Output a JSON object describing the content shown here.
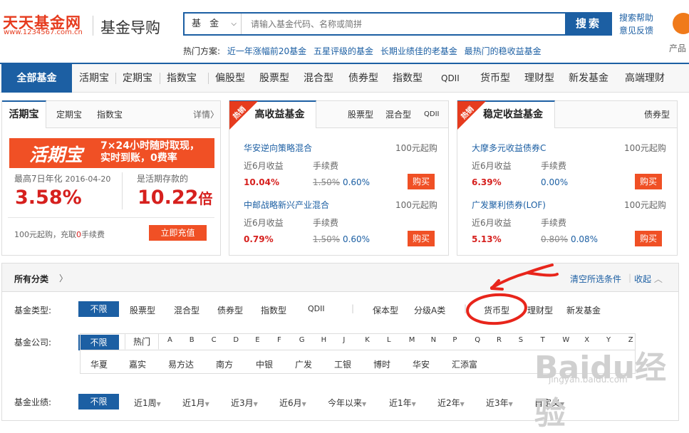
{
  "header": {
    "logo_main": "天天基金网",
    "logo_url": "www.1234567.com.cn",
    "logo_sub": "基金导购",
    "search_type": "基 金",
    "search_placeholder": "请输入基金代码、名称或简拼",
    "search_button": "搜索",
    "help_link": "搜索帮助",
    "feedback_link": "意见反馈",
    "product_label": "产品",
    "hot_label": "热门方案:",
    "hot_links": [
      "近一年涨幅前20基金",
      "五星评级的基金",
      "长期业绩佳的老基金",
      "最热门的稳收益基金"
    ]
  },
  "nav": {
    "items": [
      "全部基金",
      "活期宝",
      "定期宝",
      "指数宝",
      "偏股型",
      "股票型",
      "混合型",
      "债券型",
      "指数型",
      "QDII",
      "货币型",
      "理财型",
      "新发基金",
      "高端理财"
    ]
  },
  "card1": {
    "tabs": [
      "活期宝",
      "定期宝",
      "指数宝"
    ],
    "more": "详情",
    "promo_title": "活期宝",
    "promo_line1": "7×24小时随时取现，",
    "promo_line2": "实时到账，0费率",
    "yield_label": "最高7日年化",
    "yield_date": "2016-04-20",
    "yield_value": "3.58%",
    "compare_label": "是活期存款的",
    "compare_value": "10.22",
    "compare_unit": "倍",
    "footer_text_a": "100元起购，充取",
    "footer_zero": "0",
    "footer_text_b": "手续费",
    "recharge_button": "立即充值"
  },
  "card2": {
    "badge": "热销",
    "title": "高收益基金",
    "tabs": [
      "股票型",
      "混合型",
      "QDII"
    ],
    "funds": [
      {
        "name": "华安逆向策略混合",
        "min": "100元起购",
        "ret_label": "近6月收益",
        "fee_label": "手续费",
        "ret": "10.04%",
        "fee_old": "1.50%",
        "fee_new": "0.60%",
        "buy": "购买"
      },
      {
        "name": "中邮战略新兴产业混合",
        "min": "100元起购",
        "ret_label": "近6月收益",
        "fee_label": "手续费",
        "ret": "0.79%",
        "fee_old": "1.50%",
        "fee_new": "0.60%",
        "buy": "购买"
      }
    ]
  },
  "card3": {
    "badge": "热销",
    "title": "稳定收益基金",
    "tab": "债券型",
    "funds": [
      {
        "name": "大摩多元收益债券C",
        "min": "100元起购",
        "ret_label": "近6月收益",
        "fee_label": "手续费",
        "ret": "6.39%",
        "fee_new": "0.00%",
        "buy": "购买"
      },
      {
        "name": "广发聚利债券(LOF)",
        "min": "100元起购",
        "ret_label": "近6月收益",
        "fee_label": "手续费",
        "ret": "5.13%",
        "fee_old": "0.80%",
        "fee_new": "0.08%",
        "buy": "购买"
      }
    ]
  },
  "filter": {
    "title": "所有分类",
    "clear": "清空所选条件",
    "collapse": "收起",
    "type_label": "基金类型:",
    "type_options": [
      "不限",
      "股票型",
      "混合型",
      "债券型",
      "指数型",
      "QDII",
      "保本型",
      "分级A类",
      "货币型",
      "理财型",
      "新发基金"
    ],
    "company_label": "基金公司:",
    "company_all": "不限",
    "company_hot": "热门",
    "letters": [
      "A",
      "B",
      "C",
      "D",
      "E",
      "F",
      "G",
      "H",
      "J",
      "K",
      "L",
      "M",
      "N",
      "P",
      "Q",
      "R",
      "S",
      "T",
      "W",
      "X",
      "Y",
      "Z"
    ],
    "companies": [
      "华夏",
      "嘉实",
      "易方达",
      "南方",
      "中银",
      "广发",
      "工银",
      "博时",
      "华安",
      "汇添富"
    ],
    "perf_label": "基金业绩:",
    "perf_options": [
      "不限",
      "近1周",
      "近1月",
      "近3月",
      "近6月",
      "今年以来",
      "近1年",
      "近2年",
      "近3年",
      "自定义"
    ]
  },
  "watermark": {
    "text": "Baidu经验",
    "sub": "jingyan.baidu.com"
  },
  "colors": {
    "brand_blue": "#1c5fa3",
    "accent_orange": "#f05025",
    "annotation_red": "#e8251b"
  }
}
